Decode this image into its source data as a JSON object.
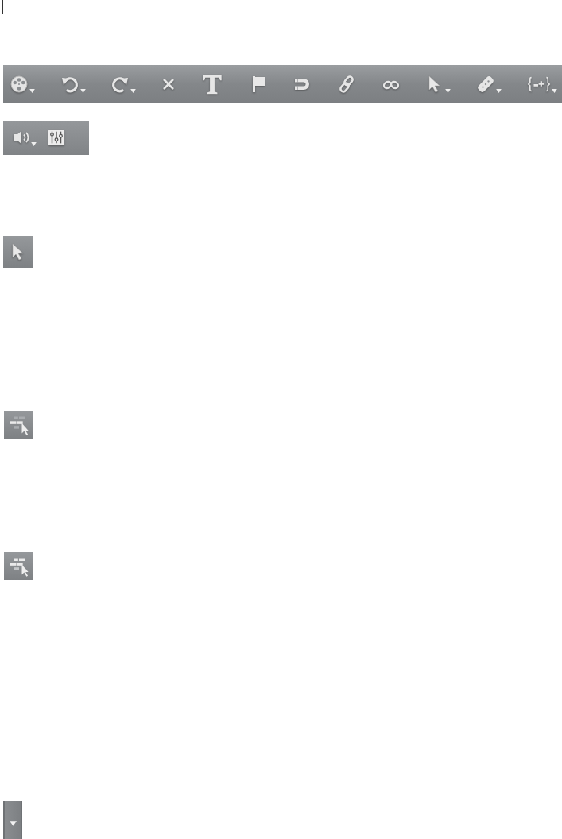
{
  "toolbar": {
    "tools": [
      {
        "kind": "reel",
        "menu": true
      },
      {
        "kind": "undo",
        "menu": true
      },
      {
        "kind": "redo",
        "menu": true
      },
      {
        "kind": "delete",
        "menu": false
      },
      {
        "kind": "text",
        "menu": false
      },
      {
        "kind": "flag",
        "menu": false
      },
      {
        "kind": "magnet",
        "menu": false
      },
      {
        "kind": "link",
        "menu": false
      },
      {
        "kind": "unlink",
        "menu": false
      },
      {
        "kind": "pointer",
        "menu": true
      },
      {
        "kind": "blade",
        "menu": true
      },
      {
        "kind": "trim",
        "menu": true
      }
    ]
  },
  "audio_panel": {
    "tools": [
      {
        "kind": "speaker",
        "menu": true
      },
      {
        "kind": "mixer",
        "menu": false
      }
    ]
  },
  "pointer_button": {
    "kind": "pointer",
    "menu": false
  },
  "snap_buttons": [
    {
      "kind": "bricks-partial"
    },
    {
      "kind": "bricks-full"
    }
  ],
  "dropdown": {
    "kind": "arrow"
  }
}
